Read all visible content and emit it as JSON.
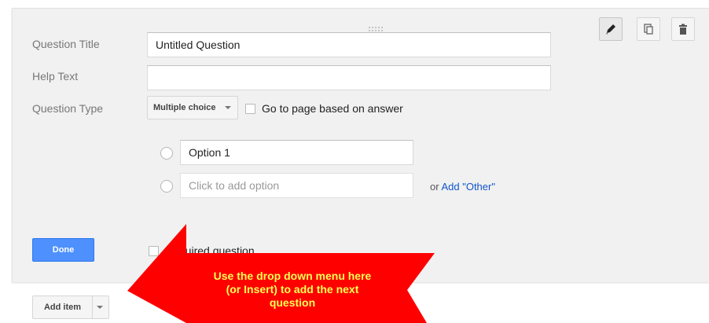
{
  "form": {
    "labels": {
      "question_title": "Question Title",
      "help_text": "Help Text",
      "question_type": "Question Type"
    },
    "question_title_value": "Untitled Question",
    "help_text_value": "",
    "question_type_value": "Multiple choice",
    "go_to_page_label": "Go to page based on answer",
    "options": [
      {
        "value": "Option 1"
      }
    ],
    "add_option_placeholder": "Click to add option",
    "or_text": "or ",
    "add_other_link": "Add \"Other\"",
    "done_label": "Done",
    "required_label": "Required question"
  },
  "toolbar": {
    "edit_icon": "pencil-icon",
    "duplicate_icon": "duplicate-icon",
    "delete_icon": "trash-icon"
  },
  "add_item_label": "Add item",
  "annotation": {
    "lines": [
      "Use the drop down menu here",
      "(or Insert) to add the next",
      "question"
    ],
    "arrow_color": "#ff0000",
    "text_color": "#ffff55"
  },
  "colors": {
    "primary_button": "#4d90fe",
    "link": "#1155cc",
    "card_bg": "#f1f1f1"
  }
}
